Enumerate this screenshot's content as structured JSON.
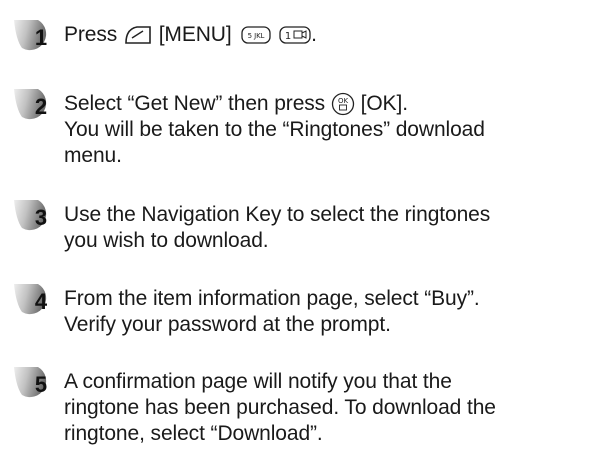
{
  "steps": [
    {
      "number": "1",
      "press_word": "Press",
      "menu_label": "[MENU]",
      "key_5_label": "5 JKL",
      "key_1_label": "1",
      "end_punct": "."
    },
    {
      "number": "2",
      "line1_before": "Select “Get New” then press",
      "ok_label": "[OK].",
      "ok_icon_text": "OK",
      "line2": "You will be taken to the “Ringtones” download",
      "line3": "menu."
    },
    {
      "number": "3",
      "line1": "Use the Navigation Key to select the ringtones",
      "line2": "you wish to download."
    },
    {
      "number": "4",
      "line1": "From the item information page, select “Buy”.",
      "line2": "Verify your password at the prompt."
    },
    {
      "number": "5",
      "line1": "A confirmation page will notify you that the",
      "line2": "ringtone has been purchased. To download the",
      "line3": "ringtone, select “Download”."
    }
  ],
  "icons": {
    "step_badge": "gradient-circle-badge",
    "soft_key": "left-soft-key-icon",
    "key5": "keypad-5-icon",
    "key1": "keypad-1-icon",
    "ok_key": "ok-key-icon"
  },
  "colors": {
    "badge_dark": "#6d6d6d",
    "badge_light": "#e4e4e4",
    "text": "#1a1a1a"
  }
}
